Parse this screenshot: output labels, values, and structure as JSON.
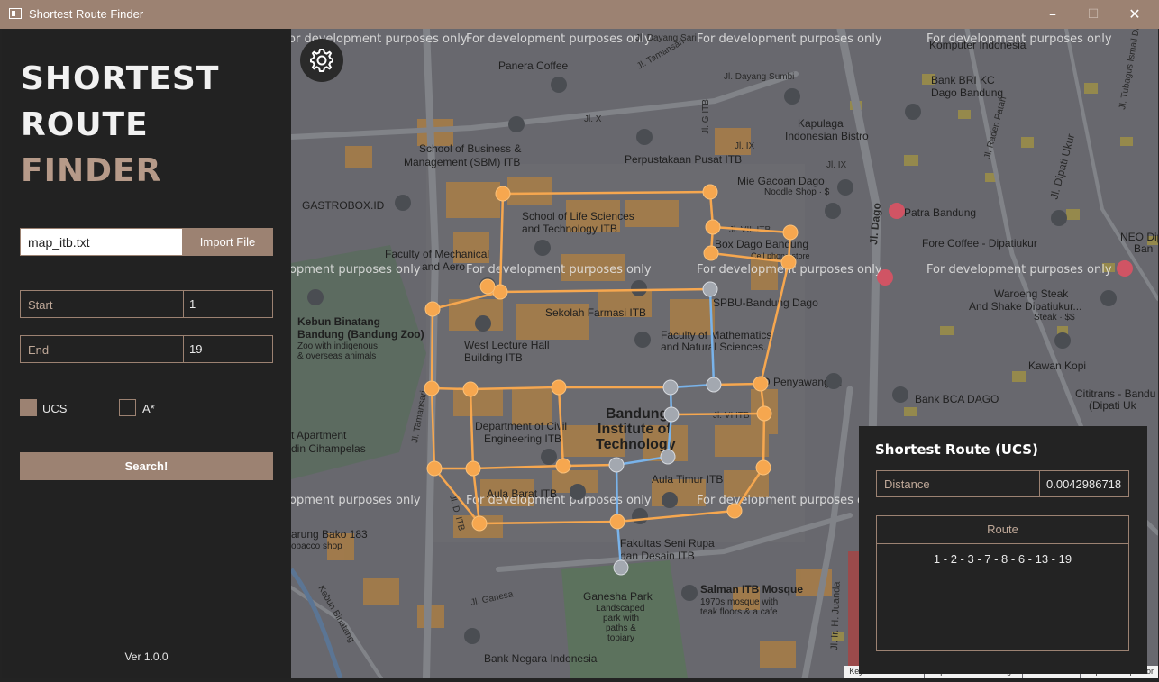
{
  "window": {
    "title": "Shortest Route Finder",
    "controls": {
      "minimize": "–",
      "maximize": "☐",
      "close": "✕"
    },
    "accent_color": "#9c8272"
  },
  "sidebar": {
    "brand": {
      "line1": "SHORTEST",
      "line2": "ROUTE",
      "line3": "FINDER"
    },
    "file": {
      "name": "map_itb.txt",
      "import_label": "Import File"
    },
    "start": {
      "label": "Start",
      "value": "1"
    },
    "end": {
      "label": "End",
      "value": "19"
    },
    "algorithms": [
      {
        "label": "UCS",
        "checked": true
      },
      {
        "label": "A*",
        "checked": false
      }
    ],
    "search_label": "Search!",
    "version": "Ver 1.0.0"
  },
  "map": {
    "settings_icon": "gear-icon",
    "watermark": "For development purposes only",
    "labels": {
      "panera": "Panera Coffee",
      "sbm1": "School of Business &",
      "sbm2": "Management (SBM) ITB",
      "perpus": "Perpustakaan Pusat ITB",
      "gastro": "GASTROBOX.ID",
      "sls1": "School of Life Sciences",
      "sls2": "and Technology ITB",
      "mech1": "Faculty of Mechanical",
      "mech2": "and Aero",
      "farmasi": "Sekolah Farmasi ITB",
      "fmipa1": "Faculty of Mathematics",
      "fmipa2": "and Natural Sciences...",
      "kebun1": "Kebun Binatang",
      "kebun2": "Bandung (Bandung Zoo)",
      "kebun3": "Zoo with indigenous",
      "kebun4": "& overseas animals",
      "wlh1": "West Lecture Hall",
      "wlh2": "Building ITB",
      "itb1": "Bandung",
      "itb2": "Institute of",
      "itb3": "Technology",
      "civil1": "Department of Civil",
      "civil2": "Engineering ITB",
      "apart1": "t Apartment",
      "apart2": "din Cihampelas",
      "aulatimur": "Aula Timur ITB",
      "aulabarat": "Aula Barat ITB",
      "fsrd1": "Fakultas Seni Rupa",
      "fsrd2": "dan Desain ITB",
      "ganesha1": "Ganesha Park",
      "ganesha2": "Landscaped",
      "ganesha3": "park with",
      "ganesha4": "paths &",
      "ganesha5": "topiary",
      "salman1": "Salman ITB Mosque",
      "salman2": "1970s mosque with",
      "salman3": "teak floors & a cafe",
      "negara": "Bank Negara Indonesia",
      "bako1": "arung Bako 183",
      "bako2": "obacco shop",
      "kapulaga1": "Kapulaga",
      "kapulaga2": "Indonesian Bistro",
      "miegacoan1": "Mie Gacoan Dago",
      "miegacoan2": "Noodle Shop · $",
      "patra": "Patra Bandung",
      "forecoffee": "Fore Coffee - Dipatiukur",
      "neo1": "NEO Dipa",
      "neo2": "Ban",
      "bri1": "Bank BRI KC",
      "bri2": "Dago Bandung",
      "komputer": "Komputer Indonesia",
      "boxdago1": "Box Dago Bandung",
      "boxdago2": "Cell phone store",
      "spbu": "SPBU-Bandung Dago",
      "waroeng1": "Waroeng Steak",
      "waroeng2": "And Shake Dipatiukur...",
      "waroeng3": "Steak · $$",
      "kawan": "Kawan Kopi",
      "bca": "Bank BCA DAGO",
      "cititrans1": "Cititrans - Bandu",
      "cititrans2": "(Dipati Uk",
      "penyawangan": "D Penyawangan",
      "dayangsari": "Jl. Dayang Sari",
      "dayangsumbi": "Jl. Dayang Sumbi",
      "tamansari": "Jl. Tamansari",
      "tamansari2": "Jl. Tamansari",
      "jlx": "Jl. X",
      "jlix": "Jl. IX",
      "jlix2": "Jl. IX",
      "jlgitb": "Jl. G ITB",
      "jlviiitb": "Jl. VIII ITB",
      "jlviitb": "Jl. VI ITB",
      "jldago": "Jl. Dago",
      "jldipatiukur": "Jl. Dipati Ukur",
      "jlradenpatah": "Jl. Raden Patah",
      "jlhjuanda": "Jl. Ir. H. Juanda",
      "jlganesa": "Jl. Ganesa",
      "kebunbinatang": "Kebun Binatang",
      "jldito": "Jl. D. ITB",
      "tubagus": "Jl. Tubagus Ismail Dalam"
    },
    "attribution": [
      "Keyboard shortcuts",
      "Map data ©2023 Google",
      "Terms of Use",
      "Report a map error"
    ],
    "graph_color": "#f6a74f",
    "path_color": "#79b3ea"
  },
  "result": {
    "title": "Shortest Route (UCS)",
    "distance_label": "Distance",
    "distance_value": "0.0042986718",
    "route_label": "Route",
    "route_value": "1 - 2 - 3 - 7 - 8 - 6 - 13 - 19"
  }
}
